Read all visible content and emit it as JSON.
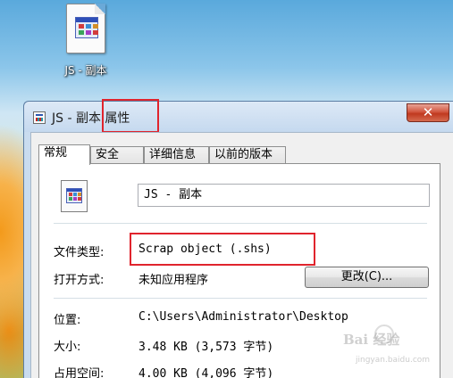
{
  "desktop": {
    "icon_label": "JS - 副本",
    "icon_name": "scrap-file-icon"
  },
  "dialog": {
    "title": "JS - 副本 属性",
    "close_icon": "close-icon",
    "tabs": [
      {
        "label": "常规",
        "active": true
      },
      {
        "label": "安全",
        "active": false
      },
      {
        "label": "详细信息",
        "active": false
      },
      {
        "label": "以前的版本",
        "active": false
      }
    ],
    "general": {
      "file_name": "JS - 副本",
      "file_type_label": "文件类型:",
      "file_type_value": "Scrap object (.shs)",
      "opens_with_label": "打开方式:",
      "opens_with_value": "未知应用程序",
      "change_button_label": "更改(C)...",
      "location_label": "位置:",
      "location_value": "C:\\Users\\Administrator\\Desktop",
      "size_label": "大小:",
      "size_value": "3.48 KB (3,573 字节)",
      "size_on_disk_label": "占用空间:",
      "size_on_disk_value": "4.00 KB (4,096 字节)"
    }
  },
  "watermark": {
    "text": "Bai 经验",
    "sub": "jingyan.baidu.com"
  },
  "colors": {
    "highlight": "#e0242d",
    "titlebar": "#c5d9ef",
    "close_button": "#c0391f"
  }
}
